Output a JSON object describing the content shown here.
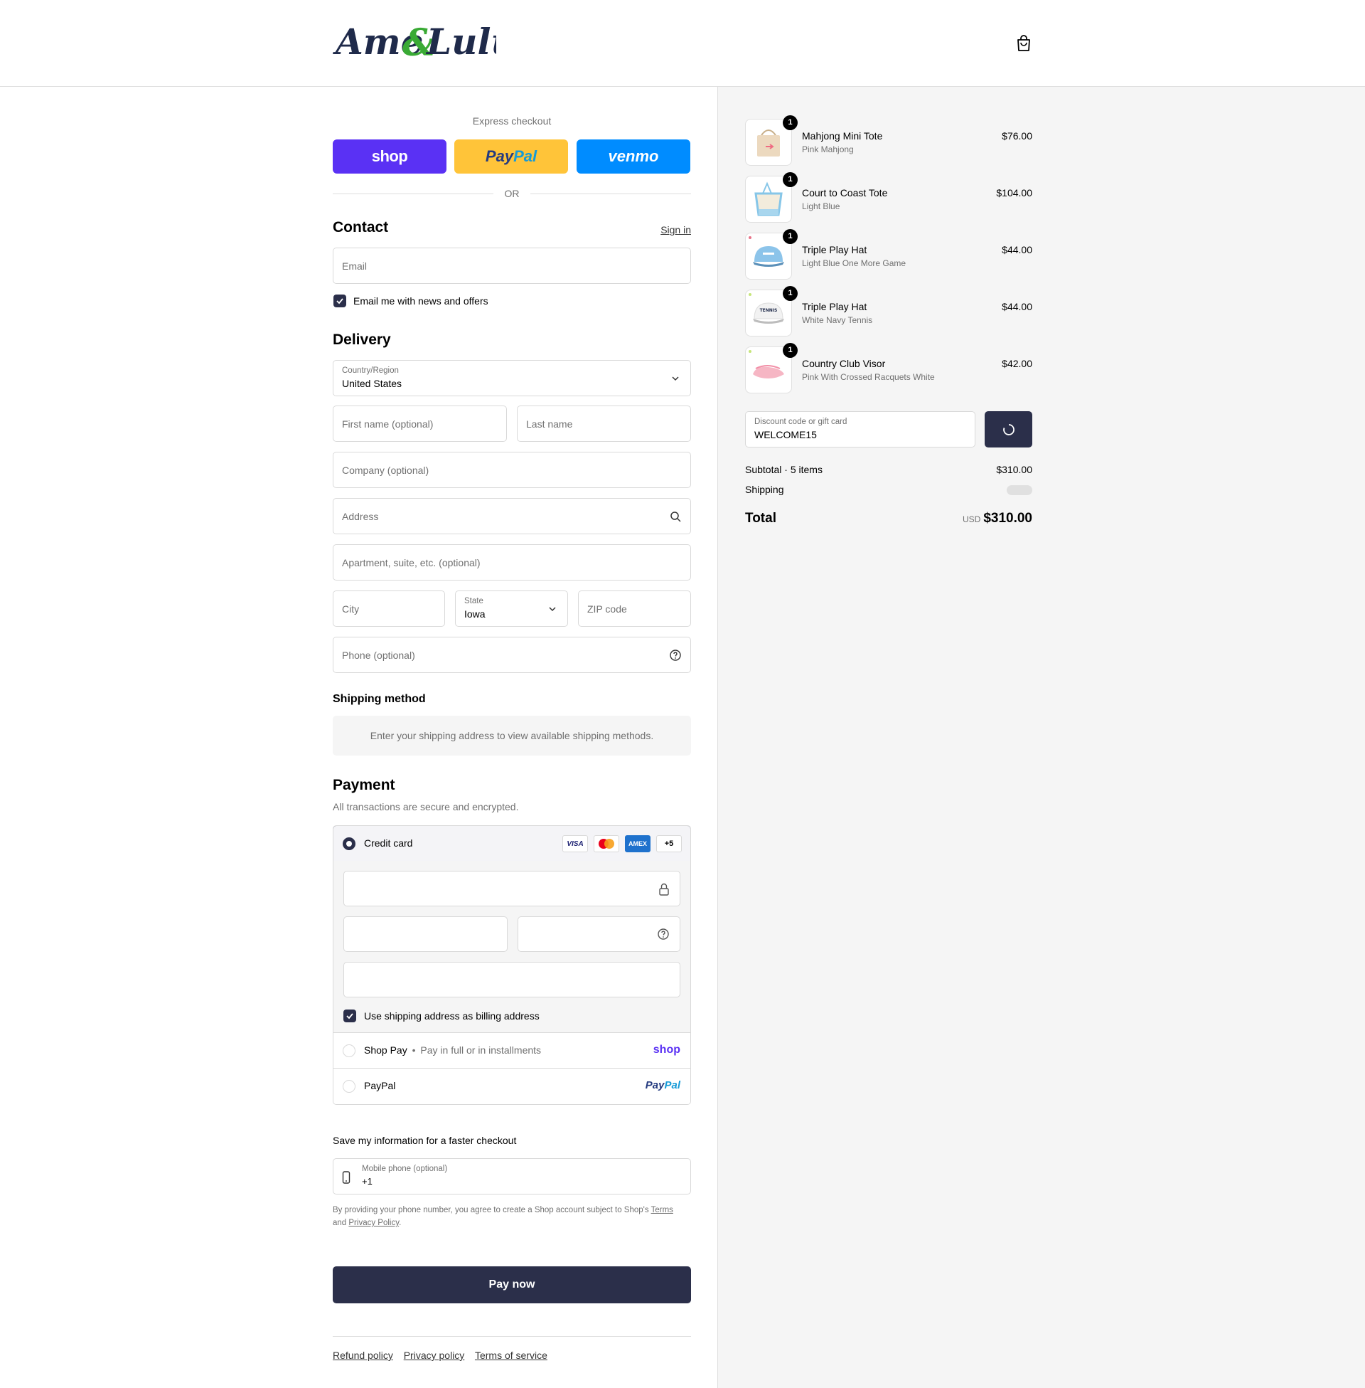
{
  "brand": {
    "logo_text_1": "Ame",
    "logo_amp": "&",
    "logo_text_2": "Lulu"
  },
  "express": {
    "title": "Express checkout",
    "shop_label": "shop",
    "paypal_label_1": "Pay",
    "paypal_label_2": "Pal",
    "venmo_label": "venmo",
    "or": "OR"
  },
  "contact": {
    "title": "Contact",
    "sign_in": "Sign in",
    "email_placeholder": "Email",
    "news_label": "Email me with news and offers",
    "news_checked": true
  },
  "delivery": {
    "title": "Delivery",
    "country_label": "Country/Region",
    "country_value": "United States",
    "first_name_placeholder": "First name (optional)",
    "last_name_placeholder": "Last name",
    "company_placeholder": "Company (optional)",
    "address_placeholder": "Address",
    "apartment_placeholder": "Apartment, suite, etc. (optional)",
    "city_placeholder": "City",
    "state_label": "State",
    "state_value": "Iowa",
    "zip_placeholder": "ZIP code",
    "phone_placeholder": "Phone (optional)"
  },
  "shipping_method": {
    "title": "Shipping method",
    "message": "Enter your shipping address to view available shipping methods."
  },
  "payment": {
    "title": "Payment",
    "subtitle": "All transactions are secure and encrypted.",
    "credit_card_label": "Credit card",
    "card_brands": [
      "VISA",
      "Mastercard",
      "AMEX"
    ],
    "more_brands": "+5",
    "billing_label": "Use shipping address as billing address",
    "shop_pay_label": "Shop Pay",
    "shop_pay_sep": "•",
    "shop_pay_desc": "Pay in full or in installments",
    "shop_pay_logo": "shop",
    "paypal_label": "PayPal",
    "paypal_logo_1": "Pay",
    "paypal_logo_2": "Pal"
  },
  "save_info": {
    "title": "Save my information for a faster checkout",
    "mobile_label": "Mobile phone (optional)",
    "mobile_value": "+1",
    "disclaimer_1": "By providing your phone number, you agree to create a Shop account subject to Shop's",
    "terms_link": "Terms",
    "disclaimer_and": "and",
    "privacy_link": "Privacy Policy",
    "disclaimer_end": "."
  },
  "pay_now": "Pay now",
  "footer": {
    "refund": "Refund policy",
    "privacy": "Privacy policy",
    "terms": "Terms of service"
  },
  "cart": {
    "items": [
      {
        "name": "Mahjong Mini Tote",
        "variant": "Pink Mahjong",
        "price": "$76.00",
        "qty": "1"
      },
      {
        "name": "Court to Coast Tote",
        "variant": "Light Blue",
        "price": "$104.00",
        "qty": "1"
      },
      {
        "name": "Triple Play Hat",
        "variant": "Light Blue One More Game",
        "price": "$44.00",
        "qty": "1"
      },
      {
        "name": "Triple Play Hat",
        "variant": "White Navy Tennis",
        "price": "$44.00",
        "qty": "1"
      },
      {
        "name": "Country Club Visor",
        "variant": "Pink With Crossed Racquets White",
        "price": "$42.00",
        "qty": "1"
      }
    ],
    "hat_text": "TENNIS",
    "discount_label": "Discount code or gift card",
    "discount_value": "WELCOME15",
    "subtotal_label": "Subtotal · 5 items",
    "subtotal_value": "$310.00",
    "shipping_label": "Shipping",
    "total_label": "Total",
    "currency": "USD",
    "total_value": "$310.00"
  },
  "colors": {
    "primary": "#2b2f4a",
    "shop": "#5a31f4",
    "paypal_yellow": "#ffc439",
    "venmo": "#008cff"
  }
}
